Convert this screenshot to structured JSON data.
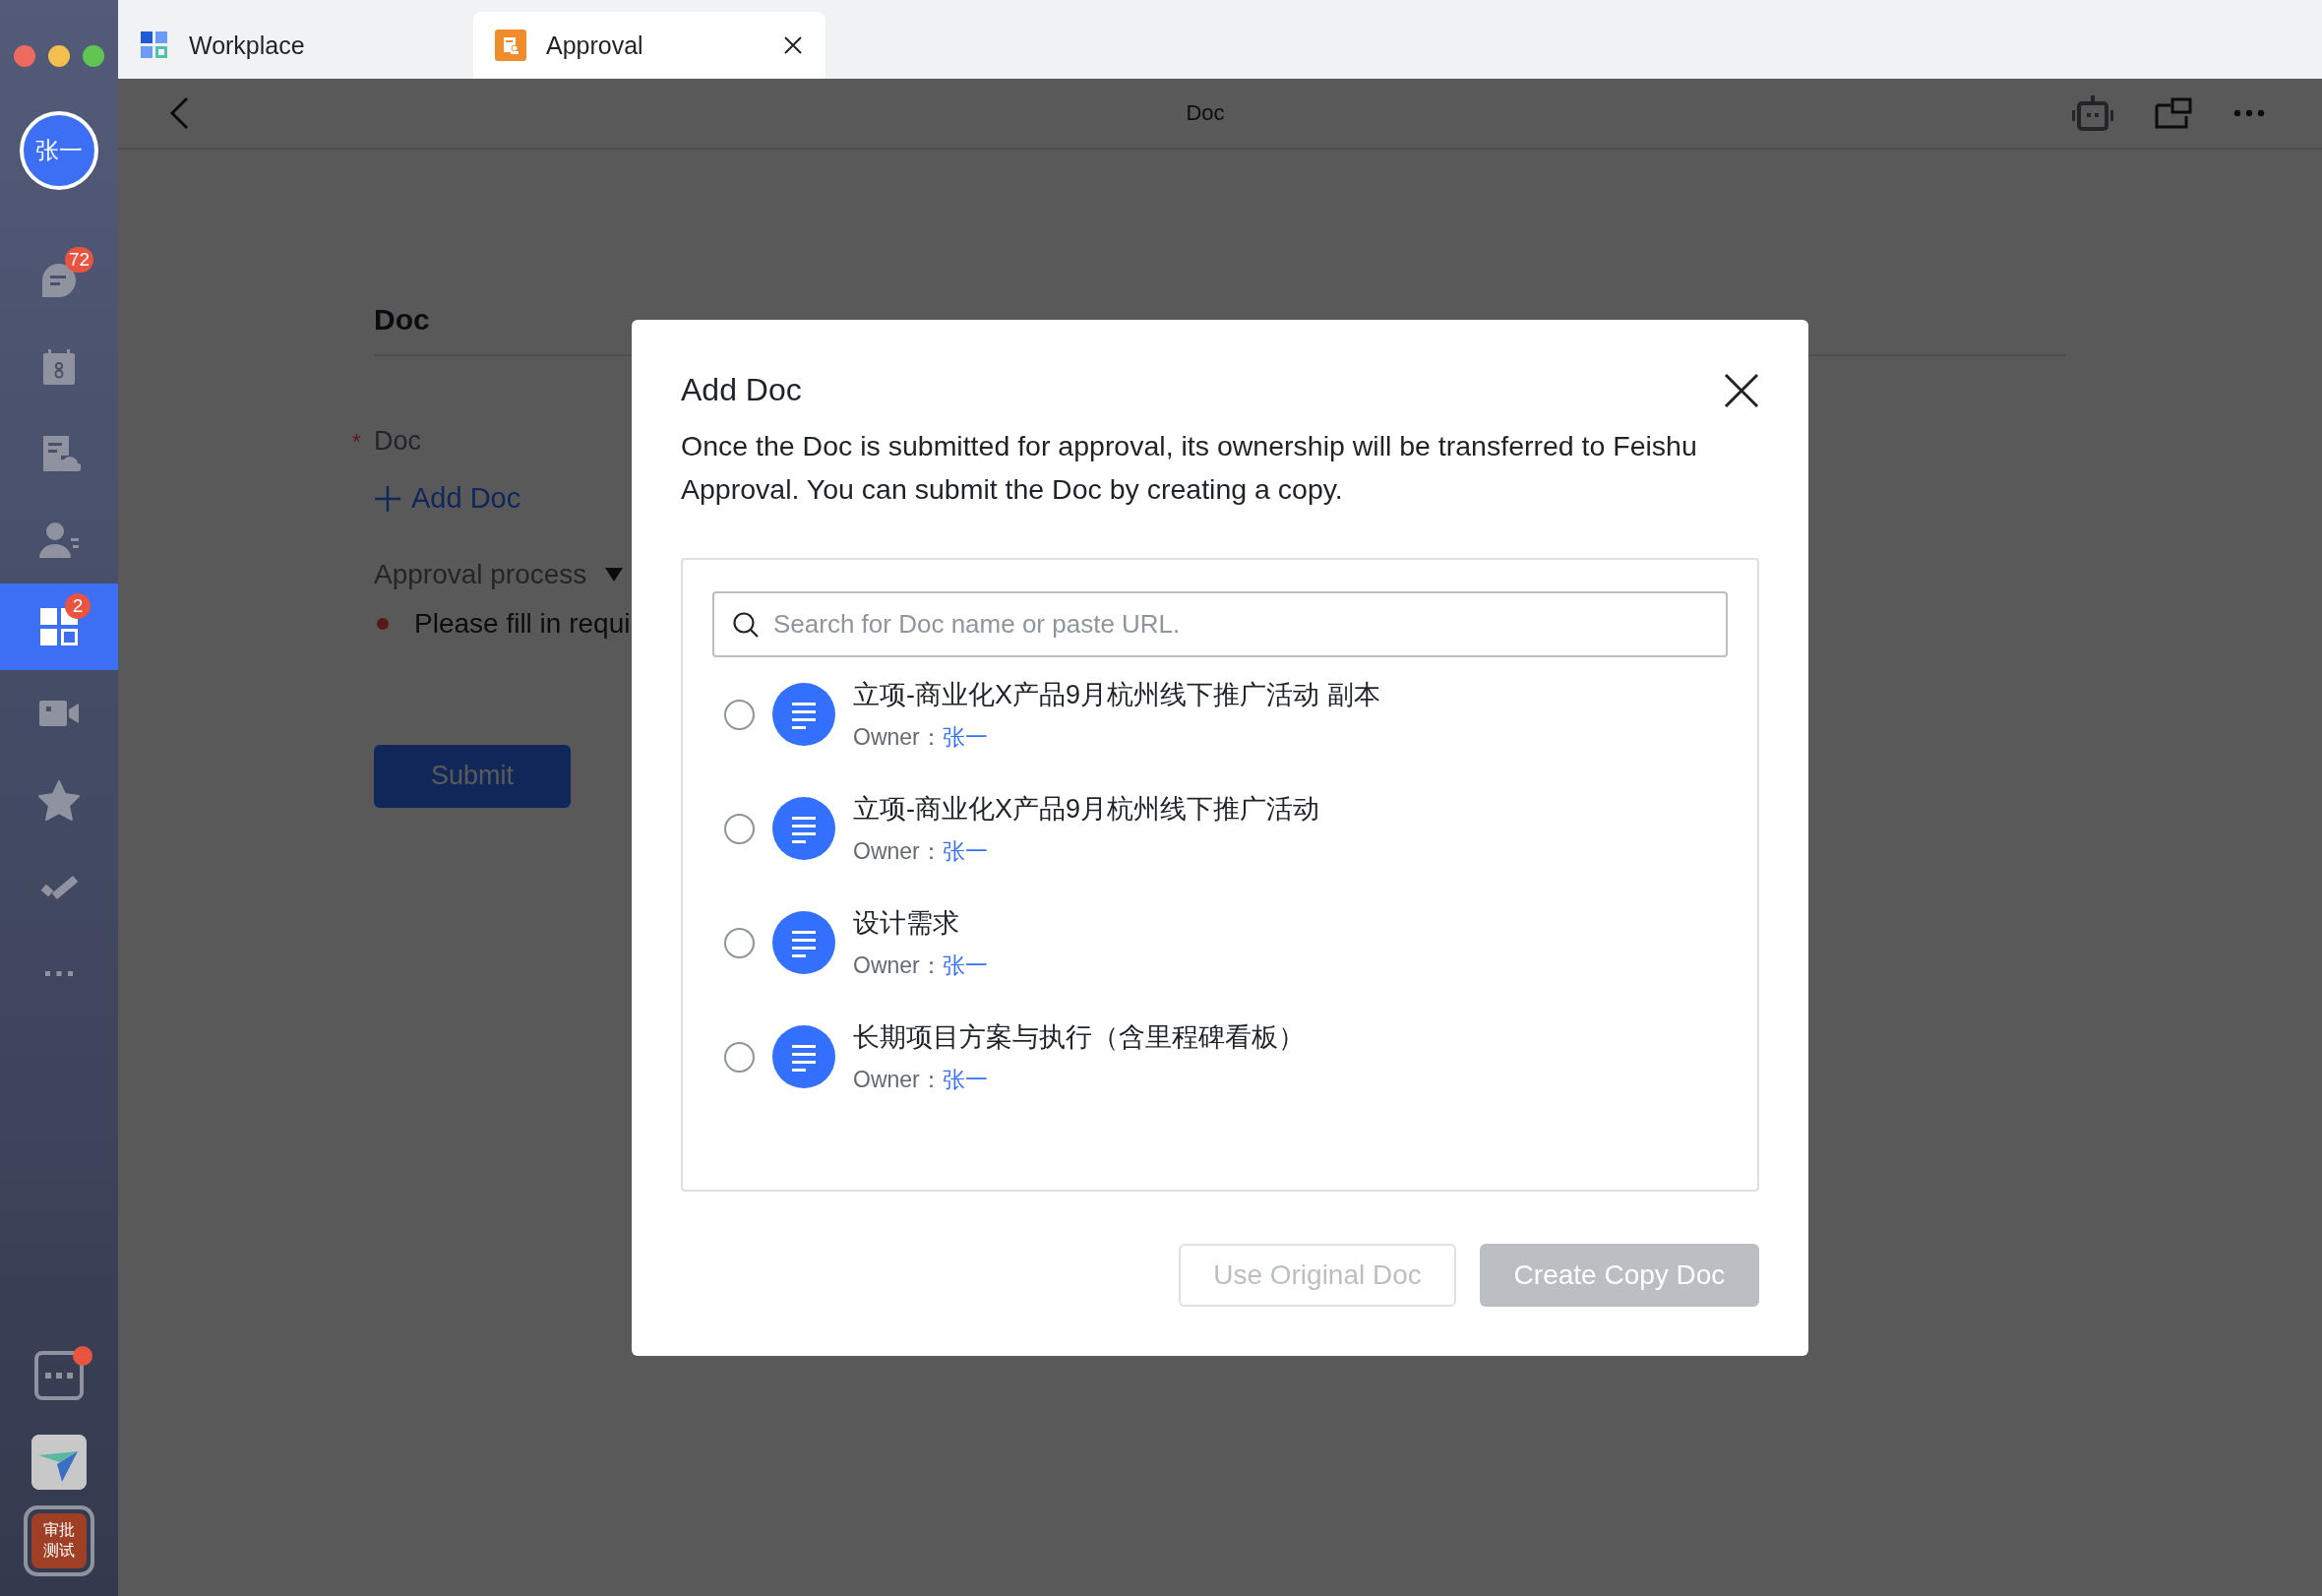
{
  "window_tabs": [
    {
      "kind": "workplace",
      "label": "Workplace",
      "selected": false,
      "closable": false
    },
    {
      "kind": "approval",
      "label": "Approval",
      "selected": true,
      "closable": true
    }
  ],
  "sidebar": {
    "avatar": "张一",
    "items": [
      {
        "kind": "chat",
        "badge": "72",
        "selected": false
      },
      {
        "kind": "calendar",
        "selected": false
      },
      {
        "kind": "docs",
        "selected": false
      },
      {
        "kind": "contacts",
        "selected": false
      },
      {
        "kind": "workplace",
        "badge": "2",
        "selected": true
      },
      {
        "kind": "video",
        "selected": false
      },
      {
        "kind": "star",
        "selected": false
      },
      {
        "kind": "tasks",
        "selected": false
      },
      {
        "kind": "more",
        "selected": false
      }
    ],
    "bottom_items": [
      {
        "kind": "more-apps",
        "dot": true
      },
      {
        "kind": "plane-app"
      },
      {
        "kind": "text-app",
        "label": "审批测试"
      }
    ]
  },
  "header": {
    "title": "Doc"
  },
  "form": {
    "section_title": "Doc",
    "field_label": "Doc",
    "required_mark": "*",
    "add_button": "Add Doc",
    "process_label": "Approval process",
    "error": "Please fill in requi",
    "submit": "Submit"
  },
  "dialog": {
    "title": "Add Doc",
    "description": "Once the Doc is submitted for approval, its ownership will be transferred to Feishu Approval. You can submit the Doc by creating a copy.",
    "search": {
      "placeholder": "Search for Doc name or paste URL."
    },
    "docs": [
      {
        "title": "立项-商业化X产品9月杭州线下推广活动 副本",
        "owner_label": "Owner：",
        "owner": "张一",
        "selected": false
      },
      {
        "title": "立项-商业化X产品9月杭州线下推广活动",
        "owner_label": "Owner：",
        "owner": "张一",
        "selected": false
      },
      {
        "title": "设计需求",
        "owner_label": "Owner：",
        "owner": "张一",
        "selected": false
      },
      {
        "title": "长期项目方案与执行（含里程碑看板）",
        "owner_label": "Owner：",
        "owner": "张一",
        "selected": false
      }
    ],
    "buttons": [
      {
        "kind": "secondary",
        "label": "Use Original Doc",
        "disabled": true
      },
      {
        "kind": "primary",
        "label": "Create Copy Doc",
        "disabled": true
      }
    ]
  }
}
